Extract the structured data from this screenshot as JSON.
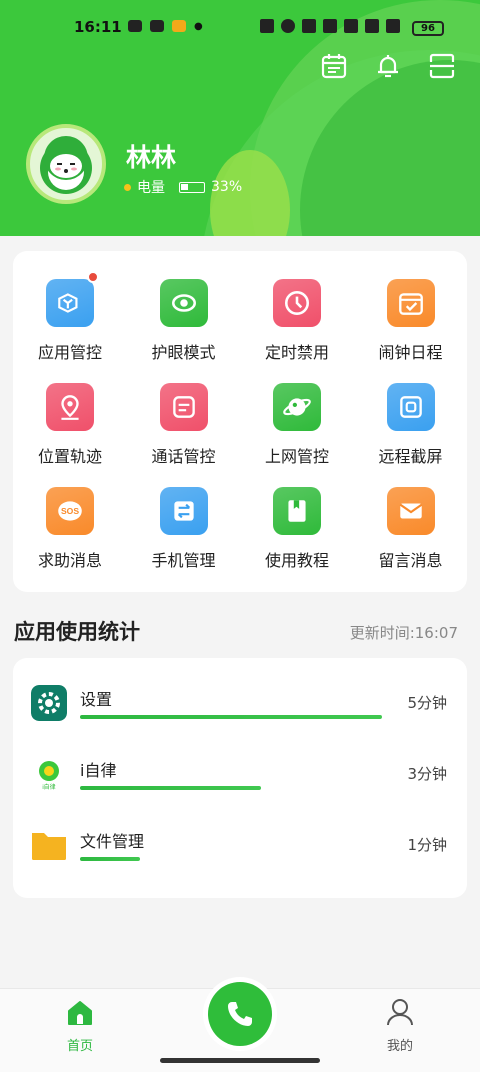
{
  "status_bar": {
    "time": "16:11",
    "battery": "96"
  },
  "header": {
    "username": "林林",
    "power_label": "电量",
    "power_percent": "33%",
    "power_level": 0.33
  },
  "grid": [
    {
      "label": "应用管控",
      "icon": "app-control-icon",
      "color": "#3aa0f0",
      "badge": true
    },
    {
      "label": "护眼模式",
      "icon": "eye-icon",
      "color": "#2fba3a",
      "badge": false
    },
    {
      "label": "定时禁用",
      "icon": "clock-icon",
      "color": "#f0506a",
      "badge": false
    },
    {
      "label": "闹钟日程",
      "icon": "calendar-check-icon",
      "color": "#f98a2a",
      "badge": false
    },
    {
      "label": "位置轨迹",
      "icon": "location-icon",
      "color": "#f0506a",
      "badge": false
    },
    {
      "label": "通话管控",
      "icon": "message-icon",
      "color": "#f0506a",
      "badge": false
    },
    {
      "label": "上网管控",
      "icon": "planet-icon",
      "color": "#2fba3a",
      "badge": false
    },
    {
      "label": "远程截屏",
      "icon": "screenshot-icon",
      "color": "#3aa0f0",
      "badge": false
    },
    {
      "label": "求助消息",
      "icon": "sos-icon",
      "color": "#f98a2a",
      "badge": false
    },
    {
      "label": "手机管理",
      "icon": "transfer-icon",
      "color": "#3aa0f0",
      "badge": false
    },
    {
      "label": "使用教程",
      "icon": "book-icon",
      "color": "#2fba3a",
      "badge": false
    },
    {
      "label": "留言消息",
      "icon": "mail-icon",
      "color": "#f98a2a",
      "badge": false
    }
  ],
  "stats": {
    "title": "应用使用统计",
    "update_time": "更新时间:16:07",
    "items": [
      {
        "name": "设置",
        "minutes": "5分钟",
        "icon": "settings-gear-icon",
        "level": 1.0
      },
      {
        "name": "i自律",
        "minutes": "3分钟",
        "icon": "izilv-logo-icon",
        "level": 0.6
      },
      {
        "name": "文件管理",
        "minutes": "1分钟",
        "icon": "folder-icon",
        "level": 0.2
      }
    ]
  },
  "nav": {
    "home_label": "首页",
    "mine_label": "我的"
  }
}
